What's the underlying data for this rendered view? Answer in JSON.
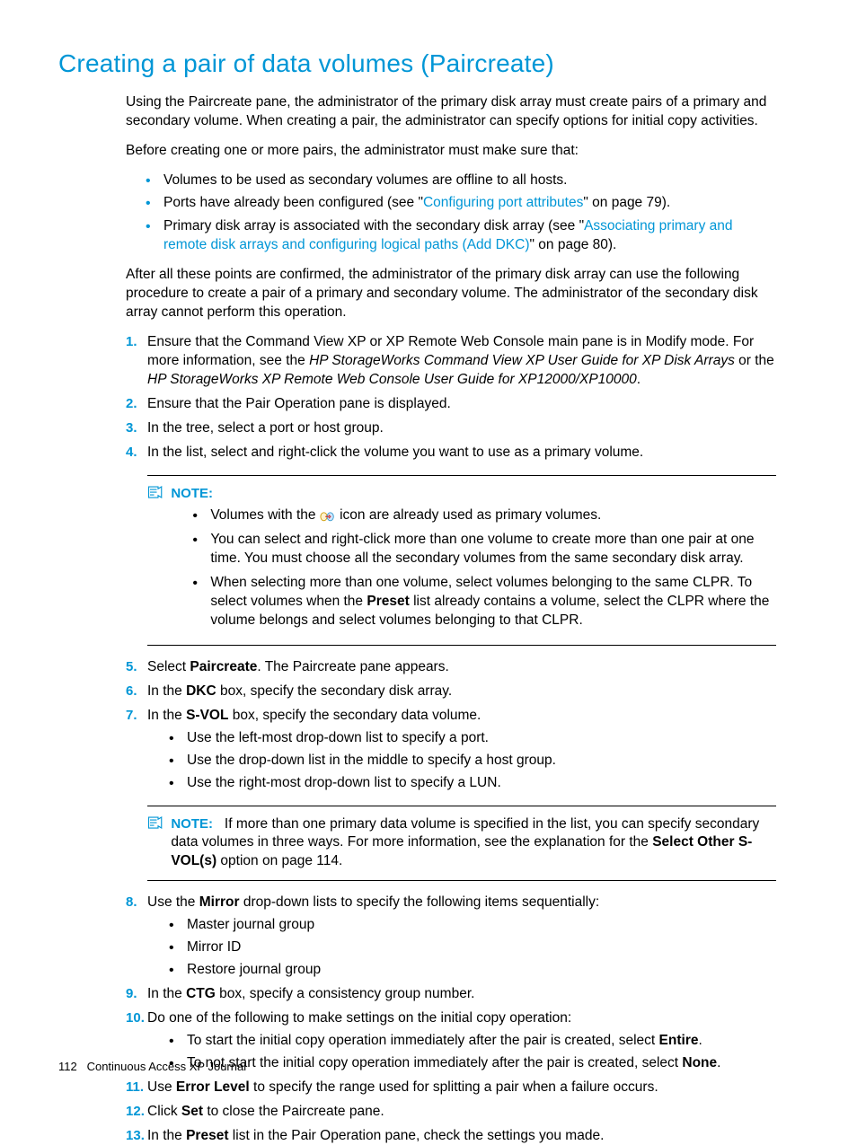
{
  "title": "Creating a pair of data volumes (Paircreate)",
  "intro": {
    "p1": "Using the Paircreate pane, the administrator of the primary disk array must create pairs of a primary and secondary volume. When creating a pair, the administrator can specify options for initial copy activities.",
    "p2": "Before creating one or more pairs, the administrator must make sure that:"
  },
  "prereq": {
    "b1": "Volumes to be used as secondary volumes are offline to all hosts.",
    "b2_pre": "Ports have already been configured (see \"",
    "b2_link": "Configuring port attributes",
    "b2_post": "\" on page 79).",
    "b3_pre": "Primary disk array is associated with the secondary disk array (see \"",
    "b3_link": "Associating primary and remote disk arrays and configuring logical paths (Add DKC)",
    "b3_post": "\" on page 80)."
  },
  "after": "After all these points are confirmed, the administrator of the primary disk array can use the following procedure to create a pair of a primary and secondary volume. The administrator of the secondary disk array cannot perform this operation.",
  "steps": {
    "s1_a": "Ensure that the Command View XP or XP Remote Web Console main pane is in Modify mode. For more information, see the ",
    "s1_i1": "HP StorageWorks Command View XP User Guide for XP Disk Arrays",
    "s1_b": " or the ",
    "s1_i2": "HP StorageWorks XP Remote Web Console User Guide for XP12000/XP10000",
    "s1_c": ".",
    "s2": "Ensure that the Pair Operation pane is displayed.",
    "s3": "In the tree, select a port or host group.",
    "s4": "In the list, select and right-click the volume you want to use as a primary volume.",
    "s5_a": "Select ",
    "s5_b": "Paircreate",
    "s5_c": ". The Paircreate pane appears.",
    "s6_a": "In the ",
    "s6_b": "DKC",
    "s6_c": " box, specify the secondary disk array.",
    "s7_a": "In the ",
    "s7_b": "S-VOL",
    "s7_c": " box, specify the secondary data volume.",
    "s7_sub1": "Use the left-most drop-down list to specify a port.",
    "s7_sub2": "Use the drop-down list in the middle to specify a host group.",
    "s7_sub3": "Use the right-most drop-down list to specify a LUN.",
    "s8_a": "Use the ",
    "s8_b": "Mirror",
    "s8_c": " drop-down lists to specify the following items sequentially:",
    "s8_sub1": "Master journal group",
    "s8_sub2": "Mirror ID",
    "s8_sub3": "Restore journal group",
    "s9_a": "In the ",
    "s9_b": "CTG",
    "s9_c": " box, specify a consistency group number.",
    "s10": "Do one of the following to make settings on the initial copy operation:",
    "s10_sub1_a": "To start the initial copy operation immediately after the pair is created, select ",
    "s10_sub1_b": "Entire",
    "s10_sub1_c": ".",
    "s10_sub2_a": "To not start the initial copy operation immediately after the pair is created, select ",
    "s10_sub2_b": "None",
    "s10_sub2_c": ".",
    "s11_a": "Use ",
    "s11_b": "Error Level",
    "s11_c": " to specify the range used for splitting a pair when a failure occurs.",
    "s12_a": "Click ",
    "s12_b": "Set",
    "s12_c": " to close the Paircreate pane.",
    "s13_a": "In the ",
    "s13_b": "Preset",
    "s13_c": " list in the Pair Operation pane, check the settings you made."
  },
  "note1": {
    "label": "NOTE:",
    "b1_a": "Volumes with the ",
    "b1_b": " icon are already used as primary volumes.",
    "b2": "You can select and right-click more than one volume to create more than one pair at one time. You must choose all the secondary volumes from the same secondary disk array.",
    "b3_a": "When selecting more than one volume, select volumes belonging to the same CLPR. To select volumes when the ",
    "b3_b": "Preset",
    "b3_c": " list already contains a volume, select the CLPR where the volume belongs and select volumes belonging to that CLPR."
  },
  "note2": {
    "label": "NOTE:",
    "text_a": "If more than one primary data volume is specified in the list, you can specify secondary data volumes in three ways. For more information, see the explanation for the ",
    "text_b": "Select Other S-VOL(s)",
    "text_c": " option on page 114."
  },
  "footer": {
    "page": "112",
    "title": "Continuous Access XP Journal"
  }
}
